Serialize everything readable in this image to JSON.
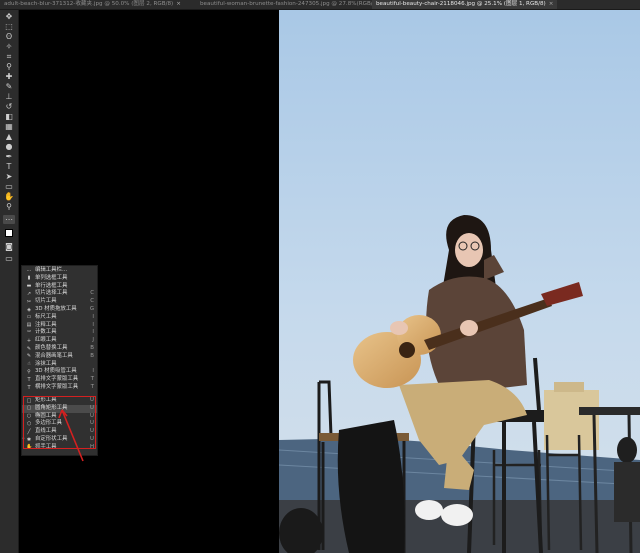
{
  "tabs": [
    {
      "label": "adult-beach-blur-371312-收藏夹.jpg @ 50.0% (图层 2, RGB/8)",
      "close": "×",
      "active": false
    },
    {
      "label": "beautiful-woman-brunette-fashion-247305.jpg @ 27.8%(RGB/8)",
      "close": "×",
      "active": false
    },
    {
      "label": "beautiful-beauty-chair-2118046.jpg @ 25.1% (图层 1, RGB/8)",
      "close": "×",
      "active": true
    }
  ],
  "toolbar_icons": [
    "move-icon",
    "marquee-icon",
    "lasso-icon",
    "magic-wand-icon",
    "crop-icon",
    "eyedropper-icon",
    "healing-icon",
    "brush-icon",
    "stamp-icon",
    "history-brush-icon",
    "eraser-icon",
    "gradient-icon",
    "blur-icon",
    "dodge-icon",
    "pen-icon",
    "type-icon",
    "path-select-icon",
    "shape-icon",
    "hand-icon",
    "zoom-icon",
    "more-icon",
    "colors-icon",
    "quickmask-icon",
    "screenmode-icon"
  ],
  "flyout": {
    "items": [
      {
        "label": "编辑工具栏...",
        "key": "",
        "icon": "⋯"
      },
      {
        "label": "单列选框工具",
        "key": "",
        "icon": "▮"
      },
      {
        "label": "单行选框工具",
        "key": "",
        "icon": "▬"
      },
      {
        "label": "切片选择工具",
        "key": "C",
        "icon": "↗"
      },
      {
        "label": "切片工具",
        "key": "C",
        "icon": "✂"
      },
      {
        "label": "3D 材质拖放工具",
        "key": "G",
        "icon": "◈"
      },
      {
        "label": "标尺工具",
        "key": "I",
        "icon": "▭"
      },
      {
        "label": "注释工具",
        "key": "I",
        "icon": "▤"
      },
      {
        "label": "计数工具",
        "key": "I",
        "icon": "¹²"
      },
      {
        "label": "红眼工具",
        "key": "J",
        "icon": "+"
      },
      {
        "label": "颜色替换工具",
        "key": "B",
        "icon": "✎"
      },
      {
        "label": "混合器画笔工具",
        "key": "B",
        "icon": "✎"
      },
      {
        "label": "涂抹工具",
        "key": "",
        "icon": "☝"
      },
      {
        "label": "3D 材质吸管工具",
        "key": "I",
        "icon": "⚲"
      },
      {
        "label": "直排文字蒙版工具",
        "key": "T",
        "icon": "T"
      },
      {
        "label": "横排文字蒙版工具",
        "key": "T",
        "icon": "T"
      },
      {
        "label": "矩形工具",
        "key": "U",
        "icon": "□"
      },
      {
        "label": "圆角矩形工具",
        "key": "U",
        "icon": "▢"
      },
      {
        "label": "椭圆工具",
        "key": "U",
        "icon": "○"
      },
      {
        "label": "多边形工具",
        "key": "U",
        "icon": "⬡"
      },
      {
        "label": "直线工具",
        "key": "U",
        "icon": "╱"
      },
      {
        "label": "自定形状工具",
        "key": "U",
        "icon": "✱"
      },
      {
        "label": "抓手工具",
        "key": "H",
        "icon": "✋"
      },
      {
        "label": "旋转视图工具",
        "key": "R",
        "icon": "↻"
      }
    ]
  }
}
